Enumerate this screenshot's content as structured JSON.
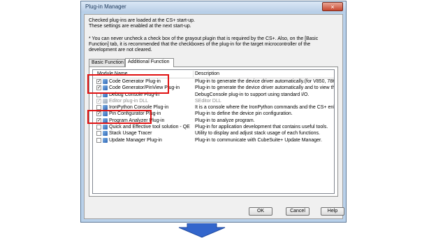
{
  "window": {
    "title": "Plug-in Manager",
    "close_icon": "×"
  },
  "intro": {
    "line1": "Checked plug-ins are loaded at the CS+ start-up.",
    "line2": "These settings are enabled at the next start-up."
  },
  "note": "* You can never uncheck a check box of the grayout plugin that is required by the CS+. Also, on the [Basic Function] tab, it is recommended that the checkboxes of the plug-in for the target microcontroller of the development are not cleared.",
  "tabs": [
    {
      "label": "Basic Function",
      "active": false
    },
    {
      "label": "Additional Function",
      "active": true
    }
  ],
  "list": {
    "col_module": "Module Name",
    "col_description": "Description",
    "rows": [
      {
        "name": "Code Generator Plug-in",
        "description": "Plug-in to generate the device driver automatically.(for V850, 78K0, 78K0R, R",
        "checked": true,
        "gray": false
      },
      {
        "name": "Code Generator/PinView Plug-in",
        "description": "Plug-in to generate the device driver automatically and to view the device co",
        "checked": true,
        "gray": false
      },
      {
        "name": "Debug Console Plug-in",
        "description": "DebugConsole plug-in to support using standard I/O.",
        "checked": false,
        "gray": false
      },
      {
        "name": "Editor plug-in DLL",
        "description": "SEditor DLL",
        "checked": true,
        "gray": true
      },
      {
        "name": "IronPython Console Plug-in",
        "description": "It is a console where the IronPython commands and the CS+ enhanced feat",
        "checked": false,
        "gray": false
      },
      {
        "name": "Pin Configurator Plug-in",
        "description": "Plug-in to define the device pin configuration.",
        "checked": true,
        "gray": false
      },
      {
        "name": "Program Analyzer Plug-in",
        "description": "Plug-in to analyze program.",
        "checked": true,
        "gray": false
      },
      {
        "name": "Quick and Effective tool solution - QE",
        "description": "Plug-in for application development that contains useful tools.",
        "checked": false,
        "gray": false
      },
      {
        "name": "Stack Usage Tracer",
        "description": "Utility to display and adjust stack usage of each functions.",
        "checked": false,
        "gray": false
      },
      {
        "name": "Update Manager Plug-in",
        "description": "Plug-in to communicate with CubeSuite+ Update Manager.",
        "checked": false,
        "gray": false
      }
    ]
  },
  "buttons": {
    "ok": "OK",
    "cancel": "Cancel",
    "help": "Help"
  },
  "colors": {
    "highlight": "#e01010",
    "arrow": "#3366cc"
  }
}
